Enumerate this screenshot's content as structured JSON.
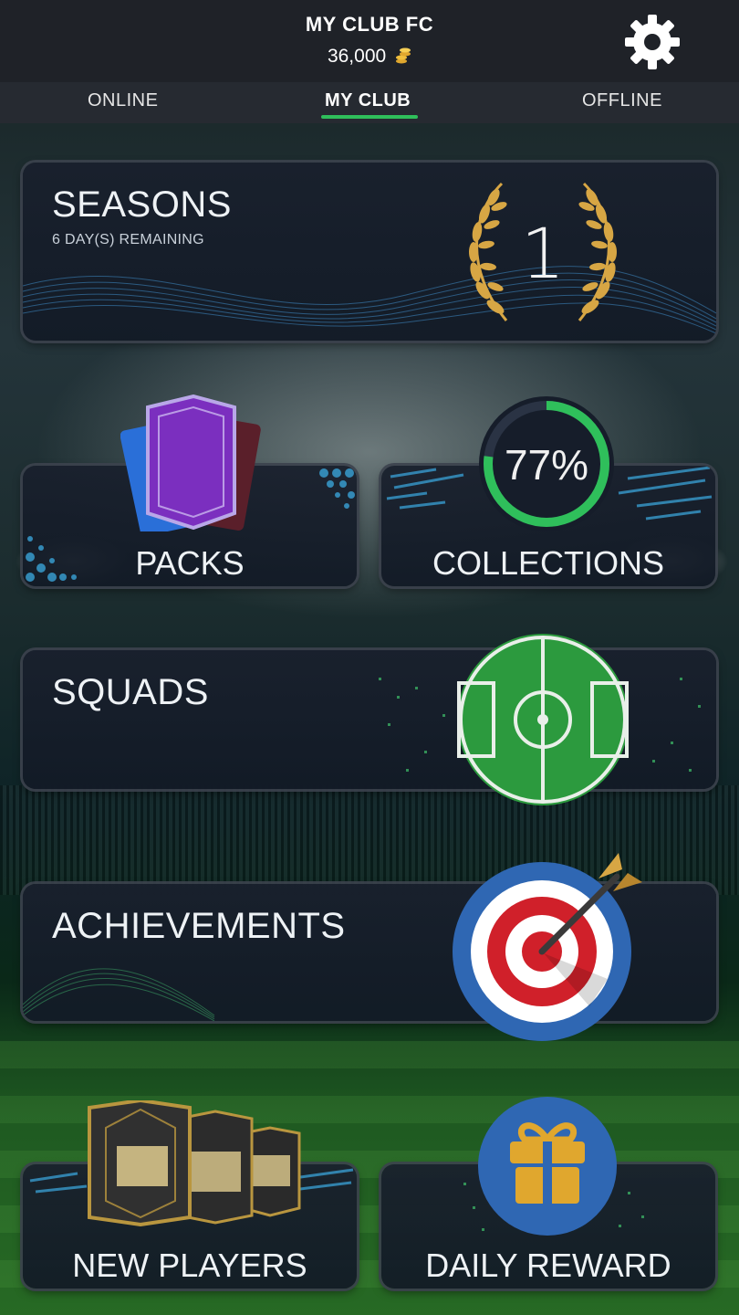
{
  "header": {
    "club_name": "MY CLUB FC",
    "coins": "36,000",
    "coin_icon": "coin-stack-icon",
    "settings_icon": "gear-icon"
  },
  "tabs": [
    {
      "label": "ONLINE",
      "active": false
    },
    {
      "label": "MY CLUB",
      "active": true
    },
    {
      "label": "OFFLINE",
      "active": false
    }
  ],
  "seasons": {
    "title": "SEASONS",
    "subtitle": "6 DAY(S) REMAINING",
    "level": "1",
    "icon": "laurel-wreath-icon"
  },
  "packs": {
    "label": "PACKS",
    "icon": "card-pack-icon"
  },
  "collections": {
    "label": "COLLECTIONS",
    "progress_text": "77%",
    "progress": 0.77
  },
  "squads": {
    "label": "SQUADS",
    "icon": "football-pitch-icon"
  },
  "achievements": {
    "label": "ACHIEVEMENTS",
    "icon": "target-dart-icon"
  },
  "new_players": {
    "label": "NEW PLAYERS",
    "icon": "player-cards-icon"
  },
  "daily_reward": {
    "label": "DAILY REWARD",
    "icon": "gift-icon"
  },
  "colors": {
    "accent_green": "#2fbf5b",
    "header_bg": "#1f2228",
    "gold": "#d7a644",
    "pitch_green": "#2c9a3e",
    "target_blue": "#2f67b3",
    "target_red": "#d0202a"
  }
}
